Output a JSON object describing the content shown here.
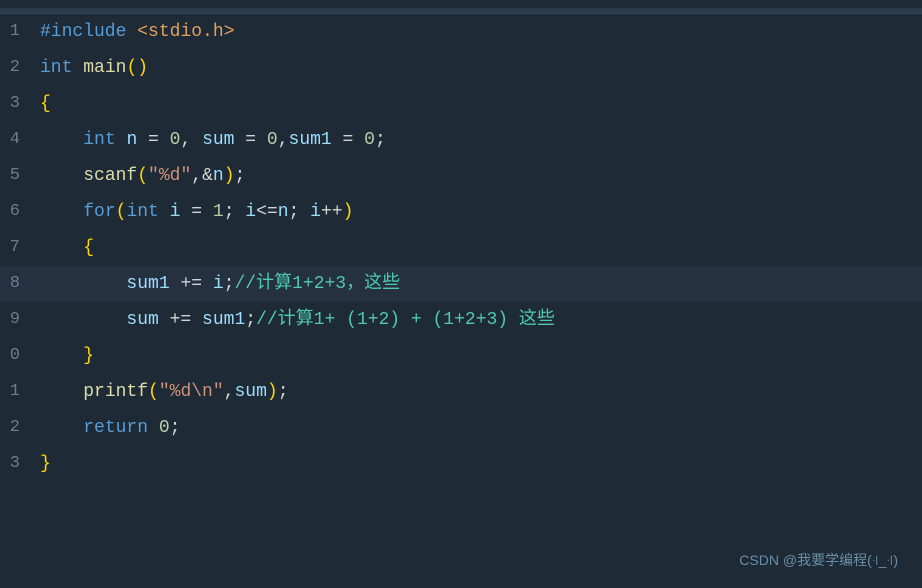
{
  "editor": {
    "background": "#1e2a35",
    "lines": [
      {
        "num": "1",
        "tokens": [
          {
            "text": "#include",
            "cls": "c-include"
          },
          {
            "text": " ",
            "cls": "c-plain"
          },
          {
            "text": "<stdio.h>",
            "cls": "c-header"
          }
        ],
        "highlight": false,
        "indent_bar": false
      },
      {
        "num": "2",
        "tokens": [
          {
            "text": "int",
            "cls": "c-keyword"
          },
          {
            "text": " ",
            "cls": "c-plain"
          },
          {
            "text": "main",
            "cls": "c-func"
          },
          {
            "text": "()",
            "cls": "c-paren"
          }
        ],
        "highlight": false,
        "indent_bar": false
      },
      {
        "num": "3",
        "tokens": [
          {
            "text": "{",
            "cls": "c-brace"
          }
        ],
        "highlight": false,
        "indent_bar": false
      },
      {
        "num": "4",
        "tokens": [
          {
            "text": "    ",
            "cls": "c-plain"
          },
          {
            "text": "int",
            "cls": "c-keyword"
          },
          {
            "text": " ",
            "cls": "c-plain"
          },
          {
            "text": "n",
            "cls": "c-var"
          },
          {
            "text": " = ",
            "cls": "c-plain"
          },
          {
            "text": "0",
            "cls": "c-number"
          },
          {
            "text": ", ",
            "cls": "c-plain"
          },
          {
            "text": "sum",
            "cls": "c-var"
          },
          {
            "text": " = ",
            "cls": "c-plain"
          },
          {
            "text": "0",
            "cls": "c-number"
          },
          {
            "text": ",",
            "cls": "c-plain"
          },
          {
            "text": "sum1",
            "cls": "c-var"
          },
          {
            "text": " = ",
            "cls": "c-plain"
          },
          {
            "text": "0",
            "cls": "c-number"
          },
          {
            "text": ";",
            "cls": "c-plain"
          }
        ],
        "highlight": false,
        "indent_bar": false
      },
      {
        "num": "5",
        "tokens": [
          {
            "text": "    ",
            "cls": "c-plain"
          },
          {
            "text": "scanf",
            "cls": "c-func"
          },
          {
            "text": "(",
            "cls": "c-paren"
          },
          {
            "text": "\"%d\"",
            "cls": "c-string"
          },
          {
            "text": ",&",
            "cls": "c-plain"
          },
          {
            "text": "n",
            "cls": "c-var"
          },
          {
            "text": ")",
            "cls": "c-paren"
          },
          {
            "text": ";",
            "cls": "c-plain"
          }
        ],
        "highlight": false,
        "indent_bar": false
      },
      {
        "num": "6",
        "tokens": [
          {
            "text": "    ",
            "cls": "c-plain"
          },
          {
            "text": "for",
            "cls": "c-keyword"
          },
          {
            "text": "(",
            "cls": "c-paren"
          },
          {
            "text": "int",
            "cls": "c-keyword"
          },
          {
            "text": " ",
            "cls": "c-plain"
          },
          {
            "text": "i",
            "cls": "c-var"
          },
          {
            "text": " = ",
            "cls": "c-plain"
          },
          {
            "text": "1",
            "cls": "c-number"
          },
          {
            "text": "; ",
            "cls": "c-plain"
          },
          {
            "text": "i",
            "cls": "c-var"
          },
          {
            "text": "<=",
            "cls": "c-plain"
          },
          {
            "text": "n",
            "cls": "c-var"
          },
          {
            "text": "; ",
            "cls": "c-plain"
          },
          {
            "text": "i",
            "cls": "c-var"
          },
          {
            "text": "++",
            "cls": "c-plain"
          },
          {
            "text": ")",
            "cls": "c-paren"
          }
        ],
        "highlight": false,
        "indent_bar": false
      },
      {
        "num": "7",
        "tokens": [
          {
            "text": "    ",
            "cls": "c-plain"
          },
          {
            "text": "{",
            "cls": "c-brace"
          }
        ],
        "highlight": false,
        "indent_bar": true
      },
      {
        "num": "8",
        "tokens": [
          {
            "text": "        ",
            "cls": "c-plain"
          },
          {
            "text": "sum1",
            "cls": "c-var"
          },
          {
            "text": " += ",
            "cls": "c-plain"
          },
          {
            "text": "i",
            "cls": "c-var"
          },
          {
            "text": ";",
            "cls": "c-plain"
          },
          {
            "text": "//计算1+2+3，这些",
            "cls": "c-comment-cn"
          }
        ],
        "highlight": true,
        "indent_bar": true
      },
      {
        "num": "9",
        "tokens": [
          {
            "text": "        ",
            "cls": "c-plain"
          },
          {
            "text": "sum",
            "cls": "c-var"
          },
          {
            "text": " += ",
            "cls": "c-plain"
          },
          {
            "text": "sum1",
            "cls": "c-var"
          },
          {
            "text": ";",
            "cls": "c-plain"
          },
          {
            "text": "//计算1+ (1+2) + (1+2+3) 这些",
            "cls": "c-comment-cn"
          }
        ],
        "highlight": false,
        "indent_bar": true
      },
      {
        "num": "0",
        "tokens": [
          {
            "text": "    ",
            "cls": "c-plain"
          },
          {
            "text": "}",
            "cls": "c-brace"
          }
        ],
        "highlight": false,
        "indent_bar": false
      },
      {
        "num": "1",
        "tokens": [
          {
            "text": "    ",
            "cls": "c-plain"
          },
          {
            "text": "printf",
            "cls": "c-func"
          },
          {
            "text": "(",
            "cls": "c-paren"
          },
          {
            "text": "\"%d\\n\"",
            "cls": "c-string"
          },
          {
            "text": ",",
            "cls": "c-plain"
          },
          {
            "text": "sum",
            "cls": "c-var"
          },
          {
            "text": ")",
            "cls": "c-paren"
          },
          {
            "text": ";",
            "cls": "c-plain"
          }
        ],
        "highlight": false,
        "indent_bar": false
      },
      {
        "num": "2",
        "tokens": [
          {
            "text": "    ",
            "cls": "c-plain"
          },
          {
            "text": "return",
            "cls": "c-keyword"
          },
          {
            "text": " ",
            "cls": "c-plain"
          },
          {
            "text": "0",
            "cls": "c-number"
          },
          {
            "text": ";",
            "cls": "c-plain"
          }
        ],
        "highlight": false,
        "indent_bar": false
      },
      {
        "num": "3",
        "tokens": [
          {
            "text": "}",
            "cls": "c-brace"
          }
        ],
        "highlight": false,
        "indent_bar": false
      }
    ],
    "line_numbers_display": [
      "1",
      "2",
      "3",
      "4",
      "5",
      "6",
      "7",
      "8",
      "9",
      "0",
      "1",
      "2",
      "3"
    ],
    "watermark": "CSDN @我要学编程(꜊_꜊)"
  }
}
